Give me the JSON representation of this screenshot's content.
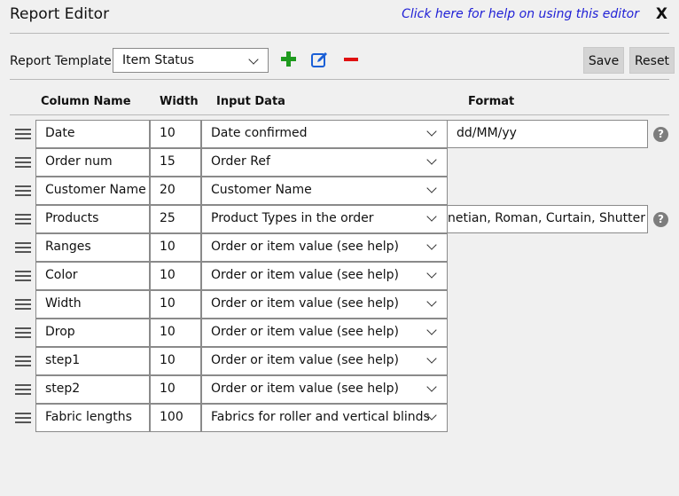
{
  "window": {
    "title": "Report Editor",
    "help_link": "Click here for help on using this editor",
    "close_label": "X"
  },
  "template": {
    "label": "Report Template",
    "selected": "Item Status",
    "save_label": "Save",
    "reset_label": "Reset"
  },
  "columns": {
    "name": "Column Name",
    "width": "Width",
    "input": "Input Data",
    "format": "Format"
  },
  "icons": {
    "add": "plus-icon",
    "edit": "edit-icon",
    "delete": "minus-icon",
    "drag": "drag-handle-icon",
    "help": "question-icon",
    "dropdown": "chevron-down-icon"
  },
  "colors": {
    "add": "#1e9a1e",
    "edit": "#1a5fd6",
    "delete": "#e01010",
    "link": "#1f1fd6"
  },
  "rows": [
    {
      "name": "Date",
      "width": "10",
      "input": "Date confirmed",
      "format": "dd/MM/yy",
      "help": "?"
    },
    {
      "name": "Order num",
      "width": "15",
      "input": "Order Ref"
    },
    {
      "name": "Customer Name",
      "width": "20",
      "input": "Customer Name"
    },
    {
      "name": "Products",
      "width": "25",
      "input": "Product Types in the order",
      "format": "netian,  Roman, Curtain, Shutter",
      "help": "?"
    },
    {
      "name": "Ranges",
      "width": "10",
      "input": "Order or item value (see help)"
    },
    {
      "name": "Color",
      "width": "10",
      "input": "Order or item value (see help)"
    },
    {
      "name": "Width",
      "width": "10",
      "input": "Order or item value (see help)"
    },
    {
      "name": "Drop",
      "width": "10",
      "input": "Order or item value (see help)"
    },
    {
      "name": "step1",
      "width": "10",
      "input": "Order or item value (see help)"
    },
    {
      "name": "step2",
      "width": "10",
      "input": "Order or item value (see help)"
    },
    {
      "name": "Fabric lengths",
      "width": "100",
      "input": "Fabrics for roller and vertical blinds"
    }
  ]
}
